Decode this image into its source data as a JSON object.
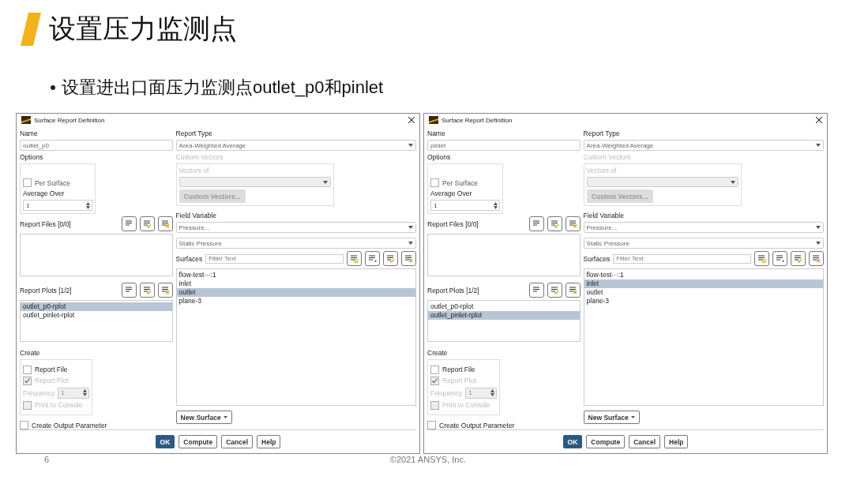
{
  "slide": {
    "title": "设置压力监测点",
    "bullet": "设置进出口面压力监测点outlet_p0和pinlet",
    "page_number": "6",
    "footer": "©2021 ANSYS, Inc."
  },
  "dialogs": [
    {
      "title": "Surface Report Definition",
      "name": {
        "label": "Name",
        "value": "outlet_p0"
      },
      "options": {
        "label": "Options",
        "per_surface": {
          "label": "Per Surface",
          "checked": false
        },
        "average_over": {
          "label": "Average Over",
          "value": "1"
        }
      },
      "report_files": {
        "label": "Report Files [0/0]"
      },
      "report_plots": {
        "label": "Report Plots [1/2]",
        "items": [
          {
            "label": "outlet_p0-rplot",
            "selected": true
          },
          {
            "label": "outlet_pinlet-rplot",
            "selected": false
          }
        ]
      },
      "create": {
        "label": "Create",
        "checks": [
          {
            "label": "Report File",
            "checked": false,
            "disabled": false
          },
          {
            "label": "Report Plot",
            "checked": true,
            "disabled": true
          }
        ],
        "frequency": {
          "label": "Frequency",
          "value": "1"
        },
        "print_to_console": {
          "label": "Print to Console",
          "checked": false,
          "disabled": true
        }
      },
      "create_output_parameter": {
        "label": "Create Output Parameter",
        "checked": false
      },
      "report_type": {
        "label": "Report Type",
        "value": "Area-Weighted Average"
      },
      "custom_vectors": {
        "label": "Custom Vectors",
        "vectors_of": "Vectors of",
        "button": "Custom Vectors..."
      },
      "field_variable": {
        "label": "Field Variable",
        "value": "Pressure...",
        "sub_value": "Static Pressure"
      },
      "surfaces": {
        "label": "Surfaces",
        "placeholder": "Filter Text",
        "items": [
          {
            "label": "flow-test···:1",
            "selected": false
          },
          {
            "label": "inlet",
            "selected": false
          },
          {
            "label": "outlet",
            "selected": true
          },
          {
            "label": "plane-3",
            "selected": false
          }
        ]
      },
      "new_surface": "New Surface",
      "buttons": [
        {
          "label": "OK",
          "kind": "primary"
        },
        {
          "label": "Compute",
          "kind": "normal"
        },
        {
          "label": "Cancel",
          "kind": "normal"
        },
        {
          "label": "Help",
          "kind": "normal"
        }
      ]
    },
    {
      "title": "Surface Report Definition",
      "name": {
        "label": "Name",
        "value": "pinlet"
      },
      "options": {
        "label": "Options",
        "per_surface": {
          "label": "Per Surface",
          "checked": false
        },
        "average_over": {
          "label": "Average Over",
          "value": "1"
        }
      },
      "report_files": {
        "label": "Report Files [0/0]"
      },
      "report_plots": {
        "label": "Report Plots [1/2]",
        "items": [
          {
            "label": "outlet_p0-rplot",
            "selected": false
          },
          {
            "label": "outlet_pinlet-rplot",
            "selected": true
          }
        ]
      },
      "create": {
        "label": "Create",
        "checks": [
          {
            "label": "Report File",
            "checked": false,
            "disabled": false
          },
          {
            "label": "Report Plot",
            "checked": true,
            "disabled": true
          }
        ],
        "frequency": {
          "label": "Frequency",
          "value": "1"
        },
        "print_to_console": {
          "label": "Print to Console",
          "checked": false,
          "disabled": true
        }
      },
      "create_output_parameter": {
        "label": "Create Output Parameter",
        "checked": false
      },
      "report_type": {
        "label": "Report Type",
        "value": "Area-Weighted Average"
      },
      "custom_vectors": {
        "label": "Custom Vectors",
        "vectors_of": "Vectors of",
        "button": "Custom Vectors..."
      },
      "field_variable": {
        "label": "Field Variable",
        "value": "Pressure...",
        "sub_value": "Static Pressure"
      },
      "surfaces": {
        "label": "Surfaces",
        "placeholder": "Filter Text",
        "items": [
          {
            "label": "flow-test···:1",
            "selected": false
          },
          {
            "label": "inlet",
            "selected": true
          },
          {
            "label": "outlet",
            "selected": false
          },
          {
            "label": "plane-3",
            "selected": false
          }
        ]
      },
      "new_surface": "New Surface",
      "buttons": [
        {
          "label": "OK",
          "kind": "primary"
        },
        {
          "label": "Compute",
          "kind": "normal"
        },
        {
          "label": "Cancel",
          "kind": "normal"
        },
        {
          "label": "Help",
          "kind": "normal"
        }
      ]
    }
  ]
}
